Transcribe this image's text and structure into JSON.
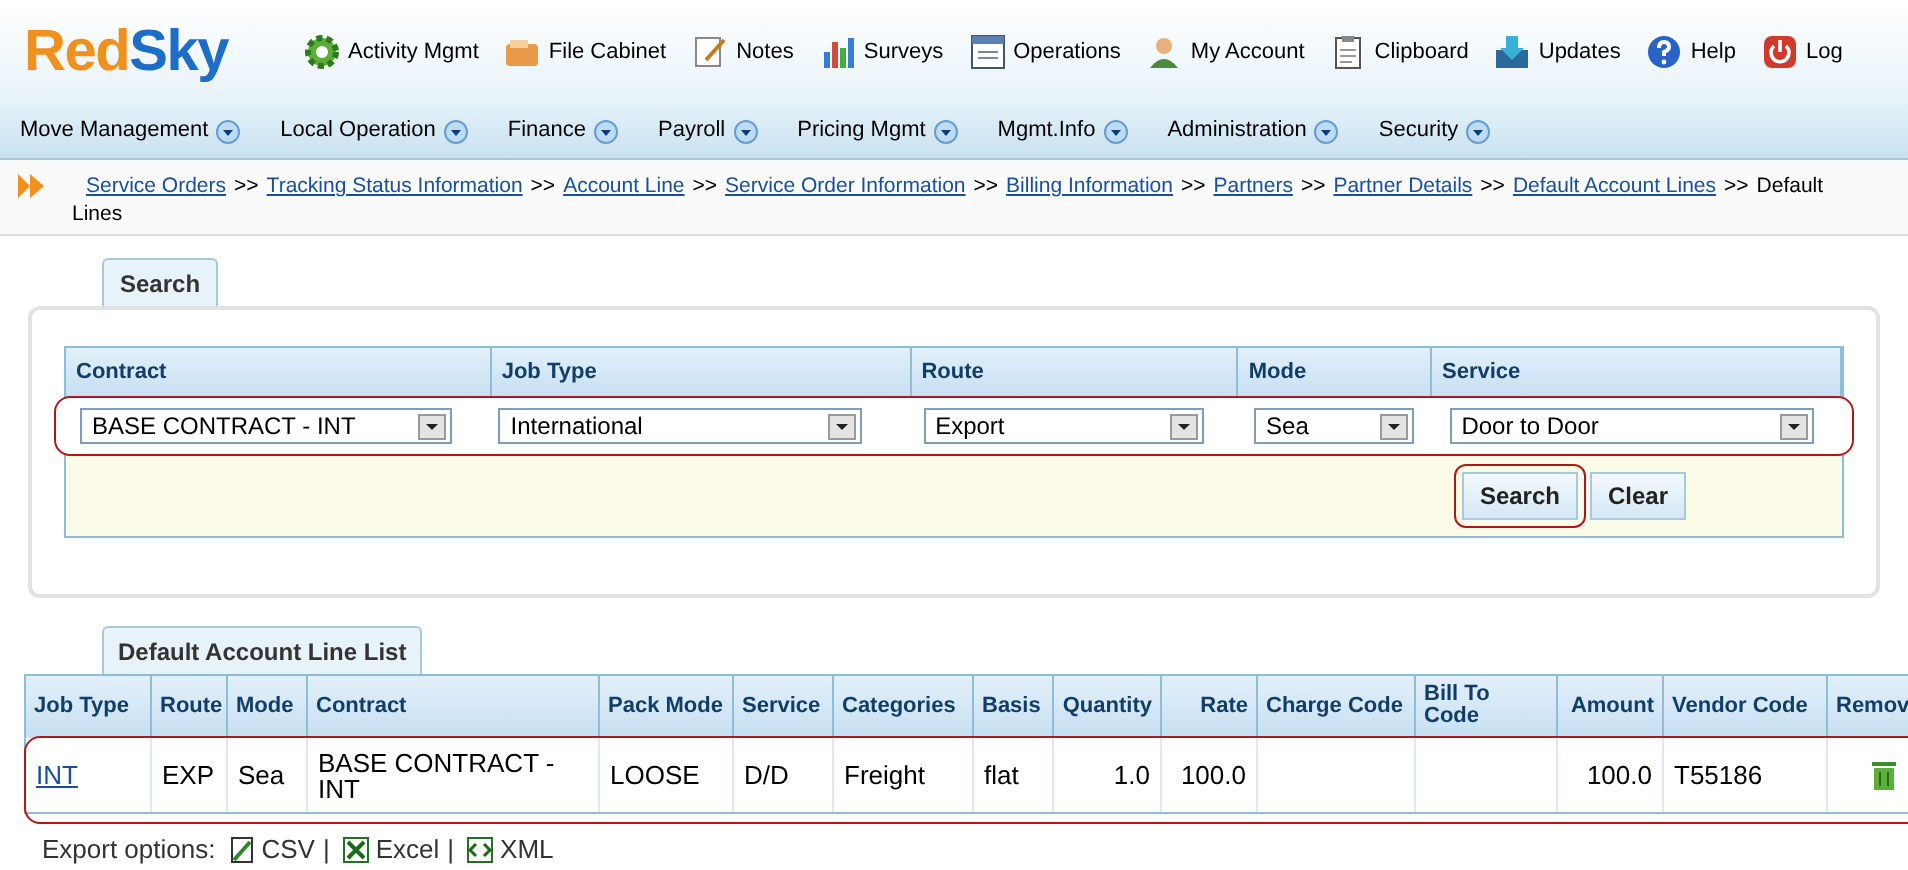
{
  "logo": {
    "part_1": "Red",
    "part_2": "Sky"
  },
  "top_links": [
    {
      "kind": "gear",
      "label": "Activity Mgmt"
    },
    {
      "kind": "cabinet",
      "label": "File Cabinet"
    },
    {
      "kind": "note",
      "label": "Notes"
    },
    {
      "kind": "chart",
      "label": "Surveys"
    },
    {
      "kind": "window",
      "label": "Operations"
    },
    {
      "kind": "person",
      "label": "My Account"
    },
    {
      "kind": "clipboard",
      "label": "Clipboard"
    },
    {
      "kind": "download",
      "label": "Updates"
    },
    {
      "kind": "help",
      "label": "Help"
    },
    {
      "kind": "power",
      "label": "Log"
    }
  ],
  "menu": [
    "Move Management",
    "Local Operation",
    "Finance",
    "Payroll",
    "Pricing Mgmt",
    "Mgmt.Info",
    "Administration",
    "Security"
  ],
  "breadcrumb": {
    "separator": ">>",
    "links": [
      "Service Orders",
      "Tracking Status Information",
      "Account Line",
      "Service Order Information",
      "Billing Information",
      "Partners",
      "Partner Details",
      "Default Account Lines"
    ],
    "current_lines": [
      "Default",
      "Lines"
    ]
  },
  "search_panel": {
    "tab": "Search",
    "columns": [
      "Contract",
      "Job Type",
      "Route",
      "Mode",
      "Service"
    ],
    "values": [
      "BASE CONTRACT - INT",
      "International",
      "Export",
      "Sea",
      "Door to Door"
    ],
    "buttons": [
      "Search",
      "Clear"
    ]
  },
  "list": {
    "tab": "Default Account Line List",
    "columns": [
      "Job Type",
      "Route",
      "Mode",
      "Contract",
      "Pack Mode",
      "Service",
      "Categories",
      "Basis",
      "Quantity",
      "Rate",
      "Charge Code",
      "Bill To Code",
      "Amount",
      "Vendor Code",
      "Remov"
    ],
    "rows": [
      {
        "cells": [
          "INT",
          "EXP",
          "Sea",
          "BASE CONTRACT - INT",
          "LOOSE",
          "D/D",
          "Freight",
          "flat",
          "1.0",
          "100.0",
          "",
          "",
          "100.0",
          "T55186"
        ]
      }
    ]
  },
  "export": {
    "label": "Export options:",
    "options": [
      "CSV",
      "Excel",
      "XML"
    ],
    "separator": "|"
  }
}
